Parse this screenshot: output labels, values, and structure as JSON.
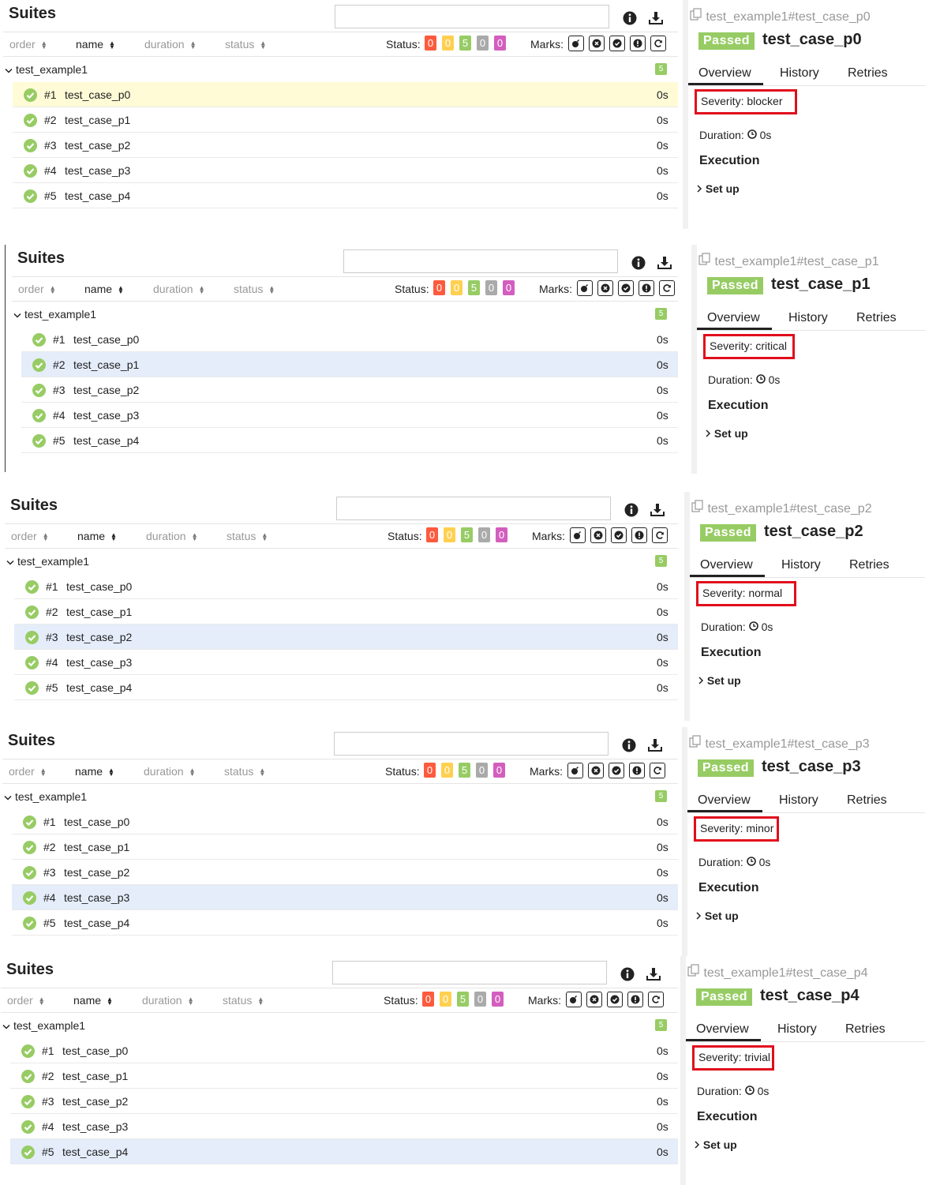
{
  "suites_label": "Suites",
  "sort_columns": [
    "order",
    "name",
    "duration",
    "status"
  ],
  "status_label": "Status:",
  "status_counts": [
    {
      "value": "0",
      "color": "#fd5a3e"
    },
    {
      "value": "0",
      "color": "#ffd050"
    },
    {
      "value": "5",
      "color": "#97cc64"
    },
    {
      "value": "0",
      "color": "#aaaaaa"
    },
    {
      "value": "0",
      "color": "#d35ebe"
    }
  ],
  "marks_label": "Marks:",
  "marks": [
    "bomb-icon",
    "times-circle-icon",
    "check-circle-icon",
    "exclamation-circle-icon",
    "refresh-icon"
  ],
  "group_name": "test_example1",
  "group_count": "5",
  "tests": [
    {
      "num": "#1",
      "name": "test_case_p0",
      "duration": "0s"
    },
    {
      "num": "#2",
      "name": "test_case_p1",
      "duration": "0s"
    },
    {
      "num": "#3",
      "name": "test_case_p2",
      "duration": "0s"
    },
    {
      "num": "#4",
      "name": "test_case_p3",
      "duration": "0s"
    },
    {
      "num": "#5",
      "name": "test_case_p4",
      "duration": "0s"
    }
  ],
  "tabs": [
    "Overview",
    "History",
    "Retries"
  ],
  "passed_label": "Passed",
  "duration_label": "Duration:",
  "duration_value": "0s",
  "execution_label": "Execution",
  "setup_label": "Set up",
  "colors": {
    "passed": "#97cc64",
    "highlight": "#e10e1d",
    "selected_yellow": "#fffbd6",
    "selected_blue": "#e5edfa"
  },
  "panels": [
    {
      "selected": 0,
      "header": "test_example1#test_case_p0",
      "title": "test_case_p0",
      "severity": "Severity: blocker",
      "selection": "yellow"
    },
    {
      "selected": 1,
      "header": "test_example1#test_case_p1",
      "title": "test_case_p1",
      "severity": "Severity: critical",
      "selection": "blue"
    },
    {
      "selected": 2,
      "header": "test_example1#test_case_p2",
      "title": "test_case_p2",
      "severity": "Severity: normal",
      "selection": "blue"
    },
    {
      "selected": 3,
      "header": "test_example1#test_case_p3",
      "title": "test_case_p3",
      "severity": "Severity: minor",
      "selection": "blue"
    },
    {
      "selected": 4,
      "header": "test_example1#test_case_p4",
      "title": "test_case_p4",
      "severity": "Severity: trivial",
      "selection": "blue"
    }
  ]
}
